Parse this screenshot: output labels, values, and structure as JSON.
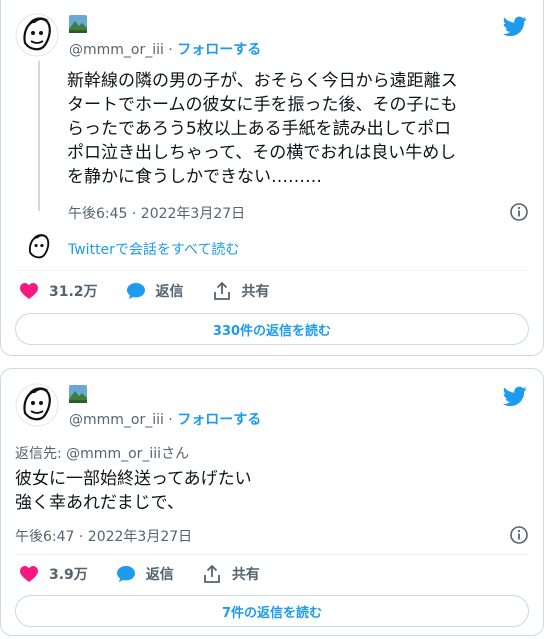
{
  "colors": {
    "accent": "#1d9bf0",
    "like": "#f91880",
    "text": "#0f1419",
    "muted": "#536471",
    "border": "#cfd9de"
  },
  "tweet1": {
    "handle": "@mmm_or_iii",
    "separator": "·",
    "follow_label": "フォローする",
    "text": "新幹線の隣の男の子が、おそらく今日から遠距離ス\nタートでホームの彼女に手を振った後、その子にも\nらったであろう5枚以上ある手紙を読み出してポロ\nポロ泣き出しちゃって、その横でおれは良い牛めし\nを静かに食うしかできない………",
    "timestamp": "午後6:45 · 2022年3月27日",
    "reply_link": "Twitterで会話をすべて読む",
    "likes": "31.2万",
    "reply_label": "返信",
    "share_label": "共有",
    "read_replies": "330件の返信を読む"
  },
  "tweet2": {
    "handle": "@mmm_or_iii",
    "separator": "·",
    "follow_label": "フォローする",
    "reply_to_prefix": "返信先: ",
    "reply_to_handle": "@mmm_or_iii",
    "reply_to_suffix": "さん",
    "text": "彼女に一部始終送ってあげたい\n強く幸あれだまじで、",
    "timestamp": "午後6:47 · 2022年3月27日",
    "likes": "3.9万",
    "reply_label": "返信",
    "share_label": "共有",
    "read_replies": "7件の返信を読む"
  },
  "icons": {
    "bird": "twitter-bird-icon",
    "heart": "heart-icon",
    "reply": "reply-bubble-icon",
    "share": "share-icon",
    "info": "info-icon"
  }
}
